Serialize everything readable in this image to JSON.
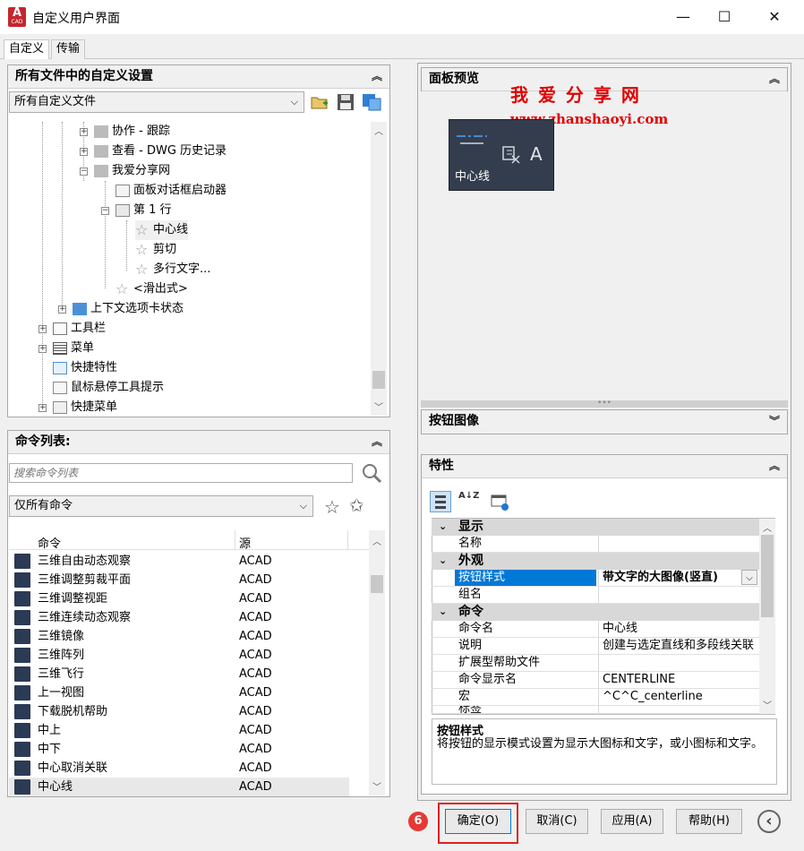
{
  "window": {
    "title": "自定义用户界面",
    "minimize": "—",
    "maximize": "☐",
    "close": "✕"
  },
  "app_icon": {
    "letter": "A",
    "sub": "CAD"
  },
  "tabs": [
    "自定义",
    "传输"
  ],
  "left_top": {
    "header": "所有文件中的自定义设置",
    "combo": "所有自定义文件",
    "tree": [
      {
        "label": "协作 - 跟踪",
        "expander": "+"
      },
      {
        "label": "查看 - DWG 历史记录",
        "expander": "+"
      },
      {
        "label": "我爱分享网",
        "expander": "−"
      },
      {
        "label": "面板对话框启动器",
        "expander": ""
      },
      {
        "label": "第 1 行",
        "expander": "−"
      },
      {
        "label": "中心线",
        "expander": ""
      },
      {
        "label": "剪切",
        "expander": ""
      },
      {
        "label": "多行文字...",
        "expander": ""
      },
      {
        "label": "<滑出式>",
        "expander": ""
      },
      {
        "label": "上下文选项卡状态",
        "expander": "+"
      },
      {
        "label": "工具栏",
        "expander": "+"
      },
      {
        "label": "菜单",
        "expander": "+"
      },
      {
        "label": "快捷特性",
        "expander": ""
      },
      {
        "label": "鼠标悬停工具提示",
        "expander": ""
      },
      {
        "label": "快捷菜单",
        "expander": "+"
      }
    ]
  },
  "commands": {
    "header": "命令列表:",
    "search_placeholder": "搜索命令列表",
    "filter": "仅所有命令",
    "col_command": "命令",
    "col_source": "源",
    "rows": [
      {
        "name": "三维自由动态观察",
        "src": "ACAD"
      },
      {
        "name": "三维调整剪裁平面",
        "src": "ACAD"
      },
      {
        "name": "三维调整视距",
        "src": "ACAD"
      },
      {
        "name": "三维连续动态观察",
        "src": "ACAD"
      },
      {
        "name": "三维镜像",
        "src": "ACAD"
      },
      {
        "name": "三维阵列",
        "src": "ACAD"
      },
      {
        "name": "三维飞行",
        "src": "ACAD"
      },
      {
        "name": "上一视图",
        "src": "ACAD"
      },
      {
        "name": "下载脱机帮助",
        "src": "ACAD"
      },
      {
        "name": "中上",
        "src": "ACAD"
      },
      {
        "name": "中下",
        "src": "ACAD"
      },
      {
        "name": "中心取消关联",
        "src": "ACAD"
      },
      {
        "name": "中心线",
        "src": "ACAD"
      }
    ]
  },
  "preview": {
    "header": "面板预览",
    "watermark_title": "我 爱 分 享 网",
    "watermark_url": "www.zhanshaoyi.com",
    "tile_label": "中心线",
    "tile_letter": "A",
    "resize_dots": "•••"
  },
  "button_image": {
    "header": "按钮图像"
  },
  "properties": {
    "header": "特性",
    "sort_label": "A↓Z",
    "cat_display": "显示",
    "name_label": "名称",
    "name_value": "",
    "cat_appearance": "外观",
    "style_label": "按钮样式",
    "style_value": "带文字的大图像(竖直)",
    "group_label": "组名",
    "group_value": "",
    "cat_command": "命令",
    "cmd_name_label": "命令名",
    "cmd_name_value": "中心线",
    "desc_label": "说明",
    "desc_value": "创建与选定直线和多段线关联",
    "help_label": "扩展型帮助文件",
    "help_value": "",
    "display_name_label": "命令显示名",
    "display_name_value": "CENTERLINE",
    "macro_label": "宏",
    "macro_value": "^C^C_centerline",
    "tag_label": "标签",
    "tag_value": "",
    "help_title": "按钮样式",
    "help_text": "将按钮的显示模式设置为显示大图标和文字，或小图标和文字。"
  },
  "buttons": {
    "step": "6",
    "ok": "确定(O)",
    "cancel": "取消(C)",
    "apply": "应用(A)",
    "help": "帮助(H)",
    "collapse": "‹"
  },
  "colors": {
    "highlight": "#0078d7",
    "tile_bg": "#333d4e",
    "watermark": "#e00000",
    "step_badge": "#e53935",
    "ok_outline": "#e02020"
  }
}
